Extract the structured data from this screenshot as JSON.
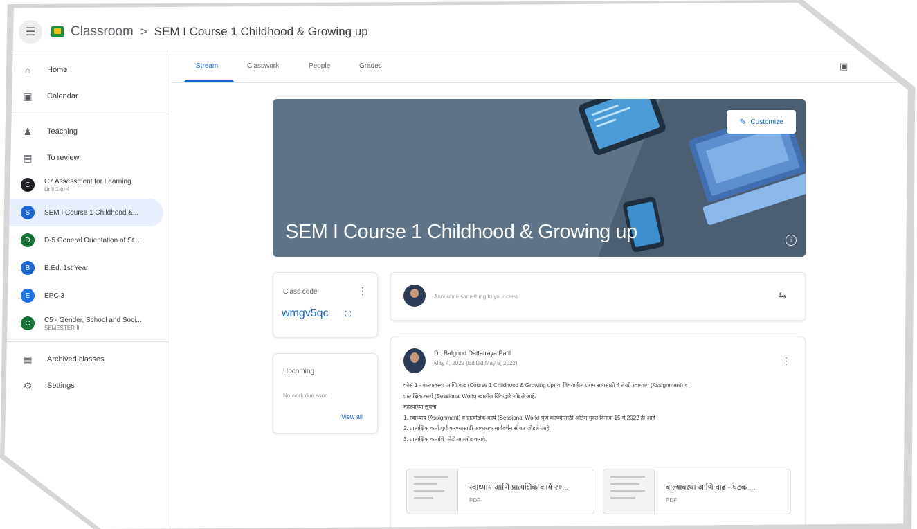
{
  "header": {
    "app_name": "Classroom",
    "separator": ">",
    "current_class": "SEM I Course 1 Childhood & Growing up"
  },
  "sidebar": {
    "nav": [
      {
        "label": "Home",
        "icon": "home-icon"
      },
      {
        "label": "Calendar",
        "icon": "calendar-icon"
      }
    ],
    "teaching_nav": [
      {
        "label": "Teaching",
        "icon": "people-icon"
      },
      {
        "label": "To review",
        "icon": "folder-icon"
      }
    ],
    "classes": [
      {
        "initial": "C",
        "name": "C7 Assessment for Learning",
        "subtitle": "Unit 1 to 4",
        "color": "#202124"
      },
      {
        "initial": "S",
        "name": "SEM I Course 1 Childhood &...",
        "subtitle": "",
        "color": "#1967d2",
        "active": true
      },
      {
        "initial": "D",
        "name": "D-5 General Orientation of St...",
        "subtitle": "",
        "color": "#137333"
      },
      {
        "initial": "B",
        "name": "B.Ed. 1st Year",
        "subtitle": "",
        "color": "#1967d2"
      },
      {
        "initial": "E",
        "name": "EPC 3",
        "subtitle": "",
        "color": "#1a73e8"
      },
      {
        "initial": "C",
        "name": "C5 - Gender, School and Soci...",
        "subtitle": "SEMESTER II",
        "color": "#137333"
      }
    ],
    "bottom_nav": [
      {
        "label": "Archived classes",
        "icon": "archive-icon"
      },
      {
        "label": "Settings",
        "icon": "settings-icon"
      }
    ]
  },
  "tabs": [
    "Stream",
    "Classwork",
    "People",
    "Grades"
  ],
  "active_tab": "Stream",
  "banner": {
    "title": "SEM I Course 1 Childhood & Growing up",
    "customize_label": "Customize"
  },
  "class_code": {
    "label": "Class code",
    "code": "wmgv5qc"
  },
  "upcoming": {
    "label": "Upcoming",
    "empty_text": "No work due soon",
    "view_all": "View all"
  },
  "announce": {
    "placeholder": "Announce something to your class"
  },
  "post": {
    "author": "Dr. Balgond Dattatraya Patil",
    "date": "May 4, 2022 (Edited May 5, 2022)",
    "body_lines": [
      "कोर्स 1 - बाल्यावस्था आणि वाढ (Course 1 Childhood & Growing up) या विषयातील प्रथम सत्रासाठी 4 लेखी स्वाध्याय (Assignment) व",
      "प्रात्यक्षिक कार्य (Sessional Work) खालील लिंकद्वारे जोडले आहे.",
      "महत्त्वाच्या सूचना",
      "1. स्वाध्याय (Assignment) व प्रात्यक्षिक कार्य (Sessional Work) पूर्ण करण्यासाठी अंतिम मुदत दिनांक 15 मे 2022 ही आहे",
      "2. प्रात्यक्षिक कार्य पूर्ण करण्यासाठी आवश्यक मार्गदर्शन सोबत जोडले आहे.",
      "3. प्रात्यक्षिक कार्याचे फोटो अपलोड करावे."
    ],
    "attachments": [
      {
        "title": "स्वाध्याय आणि प्रात्यक्षिक कार्य २०...",
        "type": "PDF"
      },
      {
        "title": "बाल्यावस्था आणि वाढ - घटक ...",
        "type": "PDF"
      }
    ]
  }
}
